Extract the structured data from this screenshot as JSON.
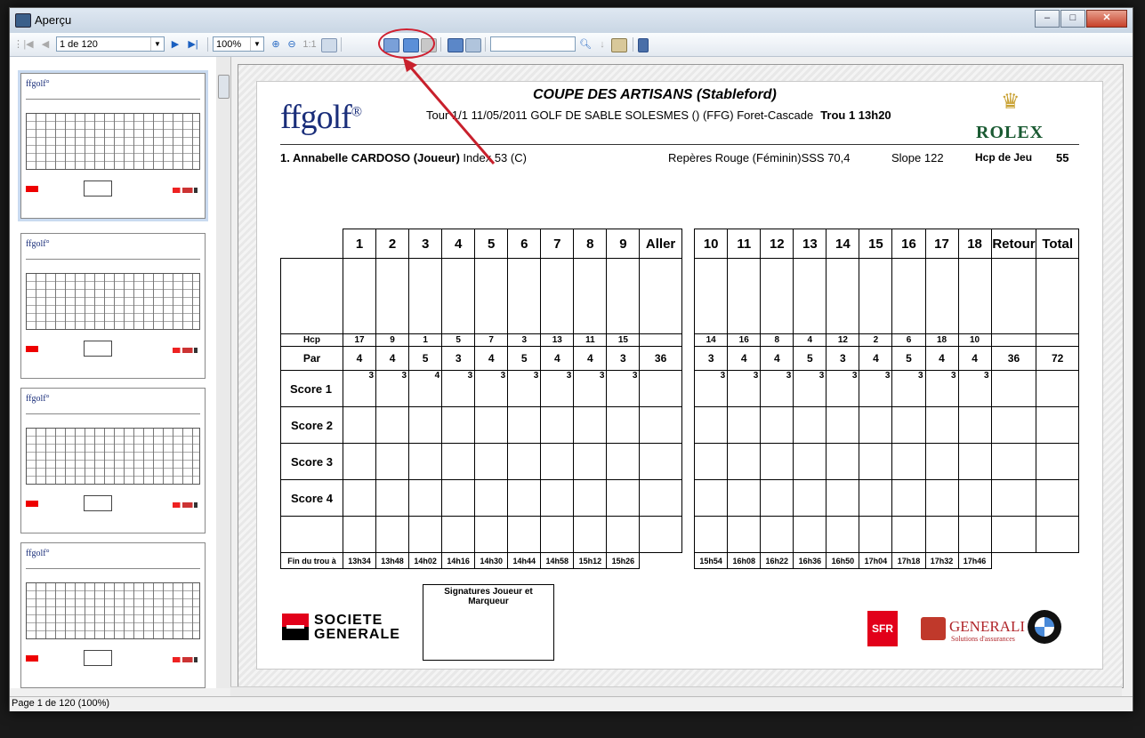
{
  "window": {
    "title": "Aperçu"
  },
  "toolbar": {
    "page_select": "1 de 120",
    "zoom": "100%",
    "zoom_1to1": "1:1",
    "search_value": ""
  },
  "doc": {
    "brand": "ffgolf",
    "title": "COUPE DES ARTISANS (Stableford)",
    "subtitle": "Tour 1/1 11/05/2011 GOLF DE SABLE SOLESMES () (FFG) Foret-Cascade",
    "trou": "Trou 1 13h20",
    "rolex": "ROLEX",
    "player_name": "1. Annabelle CARDOSO (Joueur)",
    "player_index": "Index 53 (C)",
    "reperes": "Repères Rouge (Féminin)SSS 70,4",
    "slope": "Slope 122",
    "hcp_label": "Hcp de Jeu",
    "hcp_value": "55",
    "scorecard": {
      "holes_out": [
        "1",
        "2",
        "3",
        "4",
        "5",
        "6",
        "7",
        "8",
        "9"
      ],
      "aller_label": "Aller",
      "holes_in": [
        "10",
        "11",
        "12",
        "13",
        "14",
        "15",
        "16",
        "17",
        "18"
      ],
      "retour_label": "Retour",
      "total_label": "Total",
      "hcp_label": "Hcp",
      "hcp_out": [
        "17",
        "9",
        "1",
        "5",
        "7",
        "3",
        "13",
        "11",
        "15"
      ],
      "hcp_in": [
        "14",
        "16",
        "8",
        "4",
        "12",
        "2",
        "6",
        "18",
        "10"
      ],
      "par_label": "Par",
      "par_out": [
        "4",
        "4",
        "5",
        "3",
        "4",
        "5",
        "4",
        "4",
        "3"
      ],
      "par_aller": "36",
      "par_in": [
        "3",
        "4",
        "4",
        "5",
        "3",
        "4",
        "5",
        "4",
        "4"
      ],
      "par_retour": "36",
      "par_total": "72",
      "score_labels": [
        "Score 1",
        "Score 2",
        "Score 3",
        "Score 4"
      ],
      "score1_out": [
        "3",
        "3",
        "4",
        "3",
        "3",
        "3",
        "3",
        "3",
        "3"
      ],
      "score1_in": [
        "3",
        "3",
        "3",
        "3",
        "3",
        "3",
        "3",
        "3",
        "3"
      ],
      "fin_label": "Fin du trou à",
      "fin_out": [
        "13h34",
        "13h48",
        "14h02",
        "14h16",
        "14h30",
        "14h44",
        "14h58",
        "15h12",
        "15h26"
      ],
      "fin_in": [
        "15h54",
        "16h08",
        "16h22",
        "16h36",
        "16h50",
        "17h04",
        "17h18",
        "17h32",
        "17h46"
      ]
    },
    "signature_label": "Signatures Joueur et Marqueur",
    "sponsor_sg": "SOCIETE\nGENERALE",
    "sponsor_sfr": "SFR",
    "sponsor_generali": "GENERALI",
    "sponsor_generali_sub": "Solutions d'assurances"
  },
  "status": {
    "text": "Page 1 de 120 (100%)"
  },
  "colors": {
    "highlight": "#d02030",
    "ffgolf_blue": "#1a2e7a",
    "rolex_green": "#1a5a32"
  }
}
